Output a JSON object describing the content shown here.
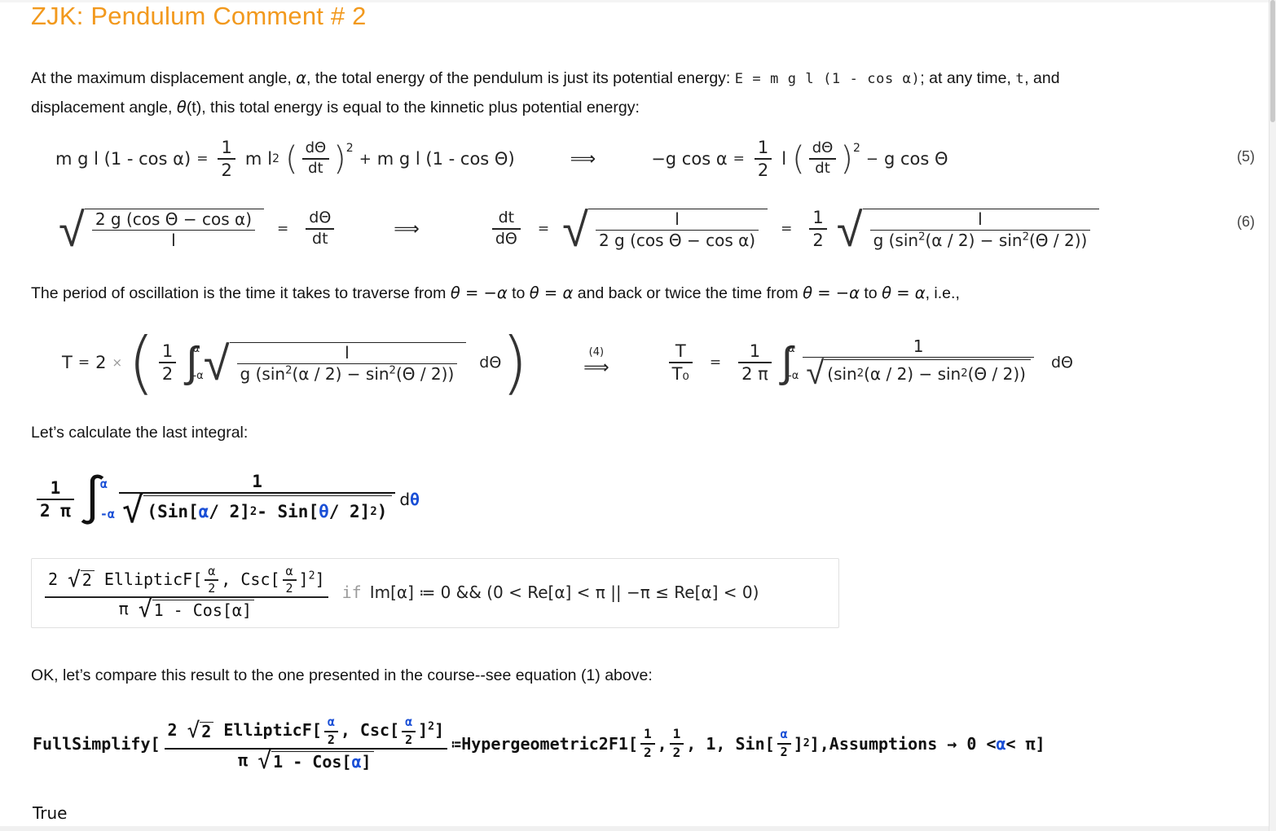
{
  "document": {
    "title": "ZJK: Pendulum Comment # 2",
    "title_color": "#f2991d"
  },
  "paragraphs": {
    "p1_line1_a": "At the maximum displacement angle, ",
    "p1_line1_alpha": "α",
    "p1_line1_b": ", the total energy of the pendulum is just its potential energy: ",
    "p1_line1_code": "E = m g l (1 - cos α)",
    "p1_line1_c": "; at any time, ",
    "p1_line1_t": "t",
    "p1_line1_d": ", and",
    "p1_line2_a": "displacement angle, ",
    "p1_line2_theta": "θ",
    "p1_line2_b": "(t), this total energy is equal to the kinnetic plus potential energy:",
    "p2_a": "The period of oscillation is the time it takes to traverse from ",
    "p2_m1": "θ = −α",
    "p2_b": " to ",
    "p2_m2": "θ = α",
    "p2_c": " and back or twice the time from ",
    "p2_m3": "θ = −α",
    "p2_d": " to ",
    "p2_m4": "θ = α",
    "p2_e": ", i.e.,",
    "p3": "Let’s calculate the last integral:",
    "p4": "OK, let’s  compare this result to the one presented in the course--see equation (1) above:"
  },
  "equations": {
    "eq5": {
      "number": "(5)",
      "lhs": "m g l (1 - cos α)",
      "eq": "=",
      "frac_num": "1",
      "frac_den": "2",
      "m": "m",
      "l2_base": "l",
      "l2_exp": "2",
      "dtheta": "dΘ",
      "dt": "dt",
      "paren_exp": "2",
      "plus": "+",
      "term2": "m g l (1 - cos Θ)",
      "implies": "⟹",
      "rhs_lhs": "−g cos α",
      "rhs_eq": "=",
      "rhs_num": "1",
      "rhs_den": "2",
      "rhs_l": "l",
      "rhs_minus": "−",
      "rhs_tail": "g cos Θ"
    },
    "eq6": {
      "number": "(6)",
      "sqrt1_num": "2 g (cos Θ  −  cos α)",
      "sqrt1_den": "l",
      "eq1": "=",
      "d_num": "dΘ",
      "d_den": "dt",
      "implies": "⟹",
      "dt_num": "dt",
      "dt_den": "dΘ",
      "eq2": "=",
      "sqrt2_num": "l",
      "sqrt2_den": "2 g (cos Θ  −  cos α)",
      "eq3": "=",
      "half_num": "1",
      "half_den": "2",
      "sqrt3_num": "l",
      "sqrt3_den_pre": "g (sin",
      "sqrt3_den_exp": "2",
      "sqrt3_den_mid": "(α / 2) − sin",
      "sqrt3_den_exp2": "2",
      "sqrt3_den_post": "(Θ / 2))"
    },
    "eqT": {
      "lhs_T": "T",
      "lhs_eq": "=",
      "lhs_2": "2",
      "times": "×",
      "half_num": "1",
      "half_den": "2",
      "int_upper": "α",
      "int_lower": "-α",
      "sqrt_num": "l",
      "sqrt_den_pre": "g (sin",
      "sqrt_den_exp": "2",
      "sqrt_den_mid": "(α / 2) − sin",
      "sqrt_den_exp2": "2",
      "sqrt_den_post": "(Θ / 2))",
      "dtheta": "dΘ",
      "implies_label": "(4)",
      "implies": "⟹",
      "T_num": "T",
      "T_den": "T₀",
      "T_eq": "=",
      "c_num": "1",
      "c_den": "2 π",
      "int2_upper": "α",
      "int2_lower": "-α",
      "f2_num": "1",
      "f2_den_pre": "(sin",
      "f2_den_exp": "2",
      "f2_den_mid": "(α / 2) − sin",
      "f2_den_exp2": "2",
      "f2_den_post": "(Θ / 2))",
      "dtheta2": "dΘ"
    }
  },
  "input_cells": {
    "integral_input": {
      "frac_num": "1",
      "frac_den": "2 π",
      "int_upper": "α",
      "int_lower": "-α",
      "f_num": "1",
      "f_den_pre": "(Sin[",
      "f_den_alpha": "α",
      "f_den_mid1": "/ 2]",
      "f_den_exp1": "2",
      "f_den_minus": "- Sin[",
      "f_den_theta": "θ",
      "f_den_mid2": "/ 2]",
      "f_den_exp2": "2",
      "f_den_close": ")",
      "d": "d",
      "d_theta": "θ"
    },
    "fullsimplify": {
      "head": "FullSimplify[",
      "num_2": "2",
      "sqrt2": "2",
      "ellipticf": "EllipticF[",
      "a1": "α",
      "two1": "2",
      "comma": ", Csc[",
      "a2": "α",
      "two2": "2",
      "close_exp": "]",
      "exp2": "2",
      "close_b": "]",
      "den_pi": "π",
      "den_1": "1 - Cos[",
      "den_alpha": "α",
      "den_close": "]",
      "eqeq": "≔",
      "hyper": "Hypergeometric2F1[",
      "h1n": "1",
      "h1d": "2",
      "h2n": "1",
      "h2d": "2",
      "h3": ", 1, Sin[",
      "h_alpha": "α",
      "h_two": "2",
      "h_close": "]",
      "h_exp": "2",
      "h_end": "],",
      "assumptions": "Assumptions → 0 <",
      "assum_alpha": "α",
      "assum_tail": "< π",
      "tail_bracket": "]"
    }
  },
  "output_cells": {
    "elliptic_result": {
      "num_2": "2",
      "sqrt2": "2",
      "ellipticf": "EllipticF[",
      "a1": "α",
      "two1": "2",
      "comma": ", Csc[",
      "a2": "α",
      "two2": "2",
      "close_exp": "]",
      "exp2": "2",
      "close_b": "]",
      "den_pi": "π",
      "den_expr": "1 - Cos[α]",
      "if_word": "if",
      "condition": "Im[α] ≔ 0 && (0 < Re[α] < π || −π ≤ Re[α] < 0)"
    },
    "true_result": "True"
  },
  "colors": {
    "title": "#f2991d",
    "input_symbol": "#1a4fd6",
    "condition_if": "#9a9a9a",
    "text": "#131313",
    "box_border": "#e0e0e0"
  }
}
